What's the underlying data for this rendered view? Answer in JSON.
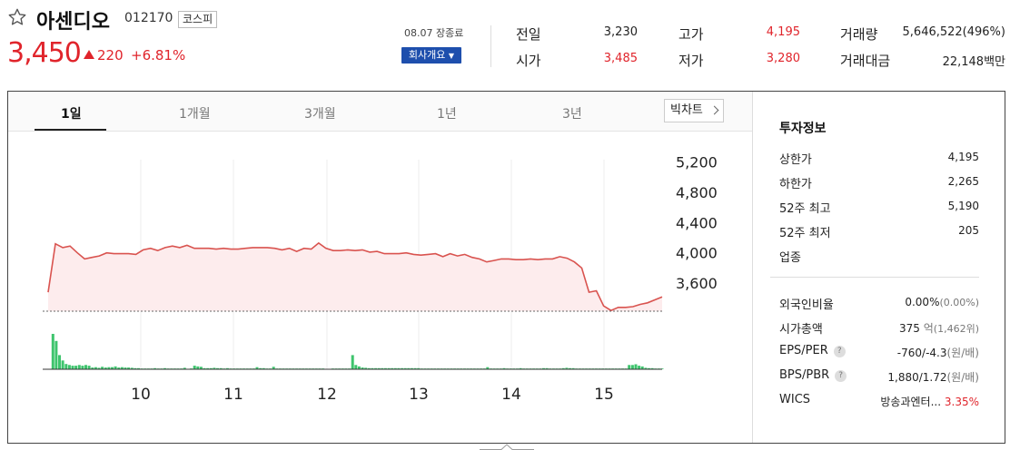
{
  "stock": {
    "name": "아센디오",
    "code": "012170",
    "market": "코스피",
    "price": "3,450",
    "change": "220",
    "change_pct": "+6.81%",
    "status_time": "08.07 장종료",
    "company_btn": "회사개요"
  },
  "quote": {
    "prev_label": "전일",
    "prev": "3,230",
    "open_label": "시가",
    "open": "3,485",
    "high_label": "고가",
    "high": "4,195",
    "low_label": "저가",
    "low": "3,280",
    "volume_label": "거래량",
    "volume": "5,646,522(496%)",
    "amount_label": "거래대금",
    "amount": "22,148백만"
  },
  "tabs": [
    "1일",
    "1개월",
    "3개월",
    "1년",
    "3년"
  ],
  "big_chart_label": "빅차트",
  "invest": {
    "title": "투자정보",
    "upper_label": "상한가",
    "upper": "4,195",
    "lower_label": "하한가",
    "lower": "2,265",
    "high52_label": "52주 최고",
    "high52": "5,190",
    "low52_label": "52주 최저",
    "low52": "205",
    "sector_label": "업종",
    "foreign_label": "외국인비율",
    "foreign": "0.00%",
    "foreign_sub": "(0.00%)",
    "mcap_label": "시가총액",
    "mcap": "375",
    "mcap_unit": "억",
    "mcap_sub": "(1,462위)",
    "eps_label": "EPS/PER",
    "eps": "-760/-4.3",
    "eps_unit": "(원/배)",
    "bps_label": "BPS/PBR",
    "bps": "1,880/1.72",
    "bps_unit": "(원/배)",
    "wics_label": "WICS",
    "wics": "방송과엔터...",
    "wics_pct": "3.35%",
    "q": "?"
  },
  "colors": {
    "up": "#e0242b",
    "down": "#1e60c9",
    "line": "#d9534f",
    "area": "#fdeced",
    "volume": "#3ec46d"
  },
  "chart_data": {
    "type": "area",
    "x_ticks": [
      "10",
      "11",
      "12",
      "13",
      "14",
      "15"
    ],
    "y_ticks": [
      "5,200",
      "4,800",
      "4,400",
      "4,000",
      "3,600"
    ],
    "ylim": [
      3350,
      5350
    ],
    "baseline": 3230,
    "price": [
      3480,
      4120,
      4070,
      4090,
      4000,
      3920,
      3940,
      3960,
      4000,
      3990,
      3990,
      3990,
      3980,
      4040,
      4060,
      4030,
      4070,
      4090,
      4070,
      4100,
      4060,
      4060,
      4060,
      4050,
      4060,
      4050,
      4050,
      4060,
      4070,
      4070,
      4070,
      4060,
      4040,
      4060,
      4020,
      4060,
      4050,
      4130,
      4060,
      4030,
      4030,
      4040,
      4030,
      4040,
      4010,
      4020,
      3990,
      3990,
      3990,
      4000,
      3980,
      3970,
      3980,
      3990,
      3950,
      3990,
      3960,
      3980,
      3940,
      3920,
      3880,
      3900,
      3920,
      3920,
      3910,
      3910,
      3920,
      3910,
      3920,
      3920,
      3950,
      3930,
      3880,
      3800,
      3480,
      3500,
      3300,
      3240,
      3280,
      3280,
      3290,
      3320,
      3340,
      3380,
      3420
    ],
    "volume": [
      0,
      0,
      100,
      80,
      40,
      25,
      15,
      12,
      10,
      10,
      12,
      10,
      12,
      10,
      5,
      6,
      4,
      7,
      5,
      6,
      6,
      8,
      5,
      6,
      5,
      5,
      4,
      3,
      3,
      2,
      2,
      2,
      2,
      3,
      2,
      2,
      3,
      2,
      2,
      2,
      2,
      2,
      4,
      1,
      2,
      10,
      8,
      7,
      3,
      3,
      3,
      4,
      3,
      3,
      2,
      3,
      2,
      2,
      2,
      2,
      2,
      2,
      2,
      2,
      6,
      3,
      3,
      2,
      2,
      7,
      2,
      2,
      2,
      2,
      2,
      2,
      2,
      2,
      2,
      2,
      2,
      2,
      2,
      2,
      2,
      1,
      1,
      2,
      2,
      2,
      2,
      2,
      2,
      40,
      12,
      8,
      5,
      4,
      3,
      3,
      3,
      3,
      3,
      3,
      3,
      3,
      3,
      3,
      3,
      3,
      3,
      3,
      3,
      3,
      2,
      2,
      2,
      2,
      2,
      2,
      2,
      2,
      2,
      2,
      2,
      2,
      2,
      2,
      2,
      2,
      2,
      2,
      2,
      2,
      6,
      2,
      2,
      2,
      2,
      3,
      2,
      2,
      2,
      2,
      3,
      2,
      2,
      2,
      2,
      2,
      2,
      3,
      3,
      2,
      2,
      2,
      2,
      3,
      4,
      3,
      3,
      2,
      2,
      2,
      2,
      2,
      2,
      2,
      2,
      2,
      2,
      2,
      2,
      2,
      2,
      2,
      2,
      12,
      12,
      14,
      10,
      8,
      4,
      3,
      3,
      2,
      2,
      2
    ]
  }
}
